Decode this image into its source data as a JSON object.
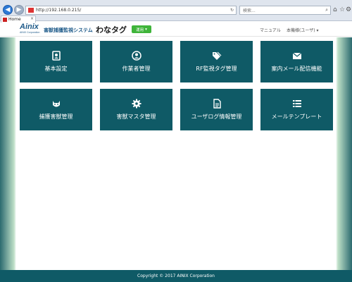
{
  "browser": {
    "url": "http://192.168.0.215/",
    "search_placeholder": "検索...",
    "tab_label": "Home",
    "tab_close": "×"
  },
  "header": {
    "logo_main": "Ainix",
    "logo_sub": "AINIX Corporation",
    "system_name": "害獣捕獲監視システム",
    "brand_title": "わなタグ",
    "mode_button": "運用",
    "manual_link": "マニュアル",
    "user_menu": "本機様(ユーザ)"
  },
  "tiles": [
    {
      "label": "基本設定",
      "icon": "contact-card-icon"
    },
    {
      "label": "作業者管理",
      "icon": "user-circle-icon"
    },
    {
      "label": "RF監視タグ管理",
      "icon": "tags-icon"
    },
    {
      "label": "案内メール配信機能",
      "icon": "envelope-icon"
    },
    {
      "label": "捕獲害獣管理",
      "icon": "animal-face-icon"
    },
    {
      "label": "害獣マスタ管理",
      "icon": "gear-icon"
    },
    {
      "label": "ユーザログ情報管理",
      "icon": "document-icon"
    },
    {
      "label": "メールテンプレート",
      "icon": "list-icon"
    }
  ],
  "footer": {
    "copyright": "Copyright © 2017 AINIX Corporation"
  },
  "colors": {
    "tile": "#0f5a66",
    "footer": "#0f5a66",
    "mode_button": "#3fb43a",
    "brand": "#1f5b8a"
  }
}
